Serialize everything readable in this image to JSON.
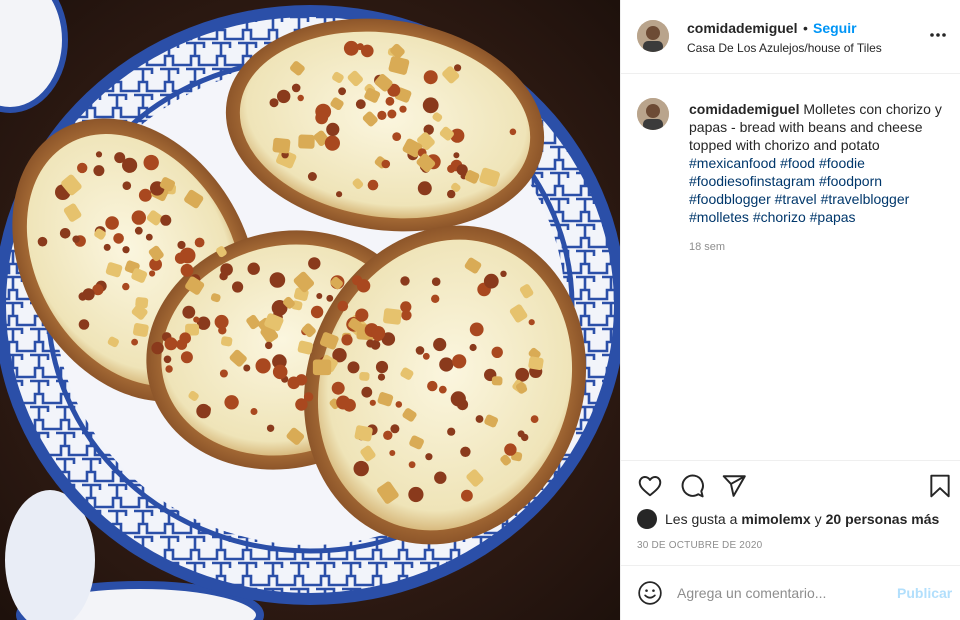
{
  "header": {
    "username": "comidademiguel",
    "separator": "•",
    "follow_label": "Seguir",
    "location": "Casa De Los Azulejos/house of Tiles",
    "more_icon": "more-horizontal-icon"
  },
  "caption": {
    "username": "comidademiguel",
    "text": " Molletes con chorizo y papas - bread with beans and cheese topped with chorizo and potato",
    "hashtags": [
      "#mexicanfood",
      "#food",
      "#foodie",
      "#foodiesofinstagram",
      "#foodporn",
      "#foodblogger",
      "#travel",
      "#travelblogger",
      "#molletes",
      "#chorizo",
      "#papas"
    ],
    "time_ago": "18 sem"
  },
  "actions": {
    "like_icon": "heart-icon",
    "comment_icon": "comment-icon",
    "share_icon": "share-icon",
    "save_icon": "bookmark-icon"
  },
  "likes": {
    "prefix": "Les gusta a",
    "user": "mimolemx",
    "joiner": "y",
    "others": "20 personas más"
  },
  "post_date": "30 DE OCTUBRE DE 2020",
  "comment": {
    "placeholder": "Agrega un comentario...",
    "publish_label": "Publicar",
    "emoji_icon": "smiley-icon"
  },
  "colors": {
    "link_blue": "#0095f6",
    "hashtag_blue": "#00376b",
    "muted_gray": "#8e8e8e",
    "publish_disabled": "#b2dffc",
    "plate_blue": "#2b4fa8"
  }
}
